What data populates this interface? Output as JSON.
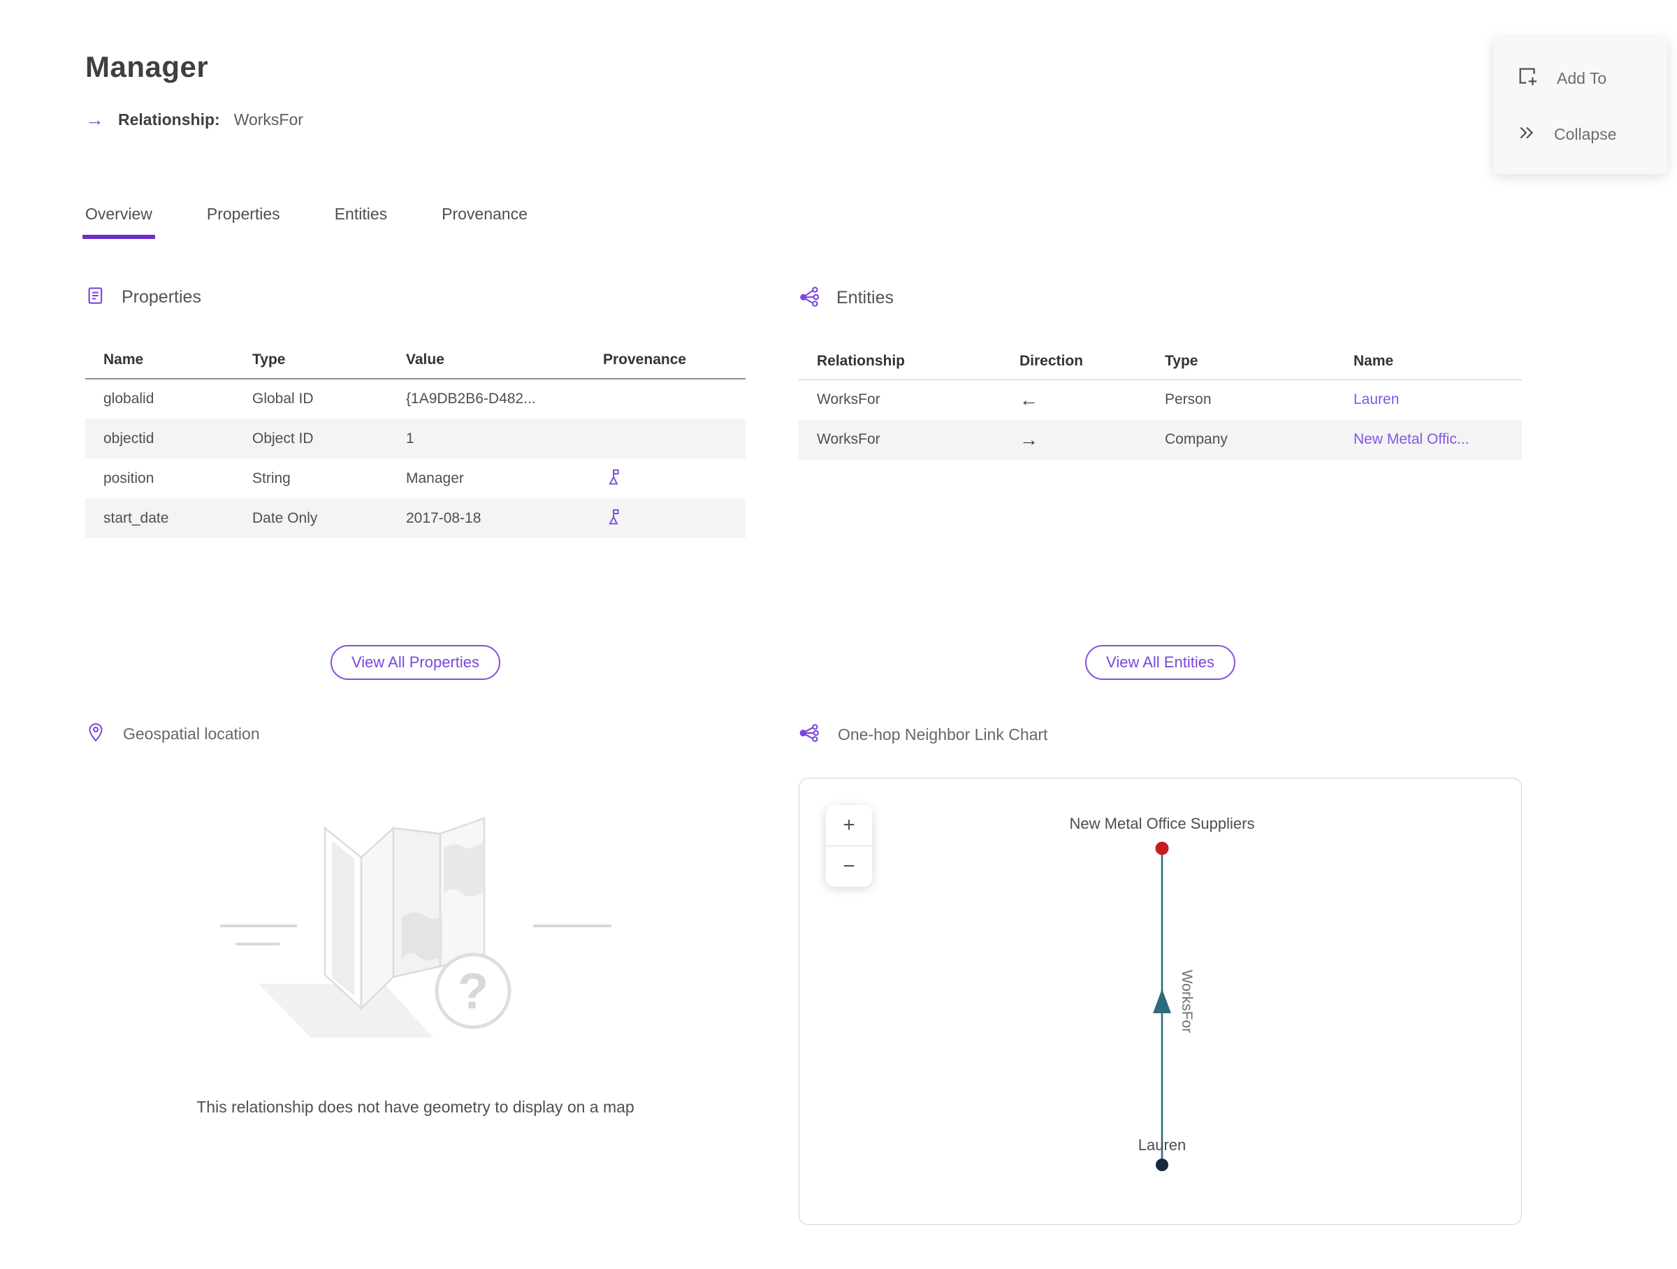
{
  "header": {
    "title": "Manager",
    "subtitle_arrow": "→",
    "subtitle_label": "Relationship:",
    "subtitle_value": "WorksFor"
  },
  "actions": {
    "add_to": "Add To",
    "collapse": "Collapse"
  },
  "tabs": [
    {
      "label": "Overview"
    },
    {
      "label": "Properties"
    },
    {
      "label": "Entities"
    },
    {
      "label": "Provenance"
    }
  ],
  "properties_section": {
    "title": "Properties",
    "columns": [
      "Name",
      "Type",
      "Value",
      "Provenance"
    ],
    "rows": [
      {
        "name": "globalid",
        "type": "Global ID",
        "value": "{1A9DB2B6-D482..."
      },
      {
        "name": "objectid",
        "type": "Object ID",
        "value": "1"
      },
      {
        "name": "position",
        "type": "String",
        "value": "Manager"
      },
      {
        "name": "start_date",
        "type": "Date Only",
        "value": "2017-08-18"
      }
    ],
    "view_all_label": "View All Properties"
  },
  "entities_section": {
    "title": "Entities",
    "columns": [
      "Relationship",
      "Direction",
      "Type",
      "Name"
    ],
    "rows": [
      {
        "relationship": "WorksFor",
        "direction": "←",
        "type": "Person",
        "name": "Lauren"
      },
      {
        "relationship": "WorksFor",
        "direction": "→",
        "type": "Company",
        "name": "New Metal Offic..."
      }
    ],
    "view_all_label": "View All Entities"
  },
  "geospatial_section": {
    "title": "Geospatial location",
    "placeholder_glyph": "?",
    "empty_message": "This relationship does not have geometry to display on a map"
  },
  "link_chart_section": {
    "title": "One-hop Neighbor Link Chart",
    "zoom_in": "+",
    "zoom_out": "−",
    "top_node_label": "New Metal Office Suppliers",
    "edge_label": "WorksFor",
    "bottom_node_label": "Lauren",
    "colors": {
      "top_node": "#c41d22",
      "bottom_node": "#17293f",
      "edge": "#2d6b7d"
    }
  },
  "colors": {
    "accent": "#7a45df",
    "link": "#8257e3",
    "tab_underline": "#6d2ecb"
  }
}
